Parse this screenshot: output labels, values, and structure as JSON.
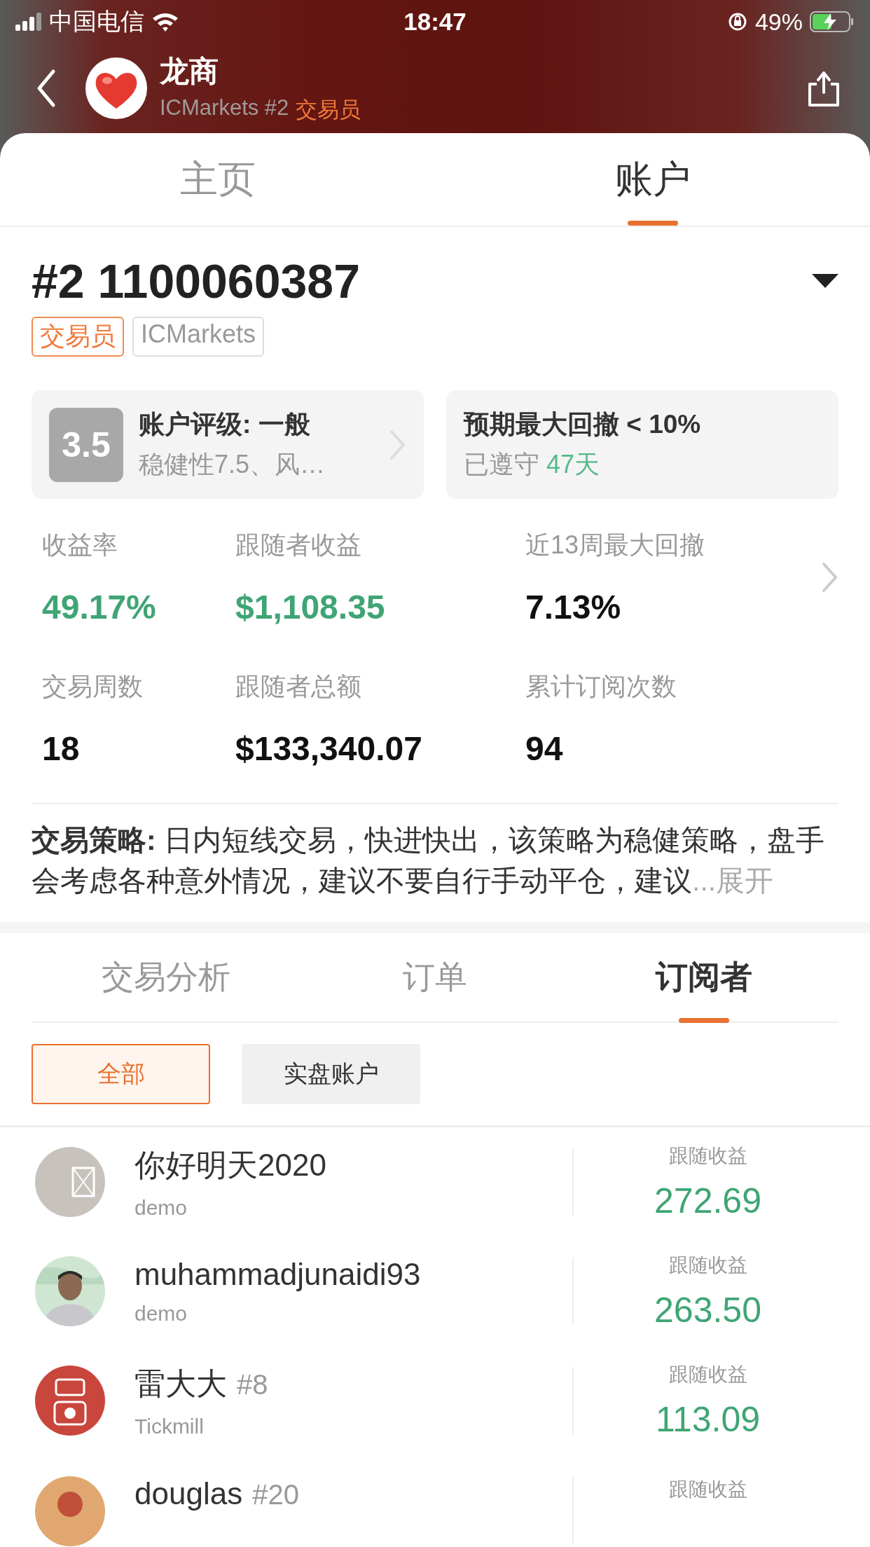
{
  "status_bar": {
    "carrier": "中国电信",
    "time": "18:47",
    "battery": "49%"
  },
  "header": {
    "name": "龙商",
    "subtitle": "ICMarkets #2",
    "role": "交易员"
  },
  "tabs": [
    {
      "label": "主页",
      "selected": false
    },
    {
      "label": "账户",
      "selected": true
    }
  ],
  "account": {
    "number": "#2 1100060387",
    "tags": [
      {
        "label": "交易员",
        "kind": "role"
      },
      {
        "label": "ICMarkets",
        "kind": "broker"
      }
    ],
    "rating": {
      "score": "3.5",
      "title": "账户评级: 一般",
      "detail": "稳健性7.5、风…"
    },
    "drawdown": {
      "title": "预期最大回撤 < 10%",
      "label": "已遵守",
      "days": "47天"
    },
    "stats": [
      {
        "label": "收益率",
        "value": "49.17%",
        "kind": "gain"
      },
      {
        "label": "跟随者收益",
        "value": "$1,108.35",
        "kind": "gain"
      },
      {
        "label": "近13周最大回撤",
        "value": "7.13%",
        "kind": "plain"
      },
      {
        "label": "交易周数",
        "value": "18",
        "kind": "plain"
      },
      {
        "label": "跟随者总额",
        "value": "$133,340.07",
        "kind": "plain"
      },
      {
        "label": "累计订阅次数",
        "value": "94",
        "kind": "plain"
      }
    ],
    "strategy": "**交易策略:** 日内短线交易，快进快出，该策略为稳健策略，盘手会考虑各种意外情况，建议不要自行手动平仓，建议",
    "expand": "...展开"
  },
  "sub_tabs": [
    {
      "label": "交易分析",
      "selected": false
    },
    {
      "label": "订单",
      "selected": false
    },
    {
      "label": "订阅者",
      "selected": true
    }
  ],
  "filters": [
    {
      "label": "全部",
      "selected": true
    },
    {
      "label": "实盘账户",
      "selected": false
    }
  ],
  "subscribers": [
    {
      "name": "你好明天2020",
      "broker": "demo",
      "earnings_label": "跟随收益",
      "earnings": "272.69",
      "kind": "placeholder"
    },
    {
      "name": "muhammadjunaidi93",
      "broker": "demo",
      "earnings_label": "跟随收益",
      "earnings": "263.50",
      "kind": "picture"
    },
    {
      "name": "雷大大",
      "rank": "#8",
      "broker": "Tickmill",
      "earnings_label": "跟随收益",
      "earnings": "113.09",
      "kind": "picture"
    },
    {
      "name": "douglas",
      "rank": "#20",
      "earnings_label": "跟随收益",
      "kind": "picture"
    }
  ]
}
